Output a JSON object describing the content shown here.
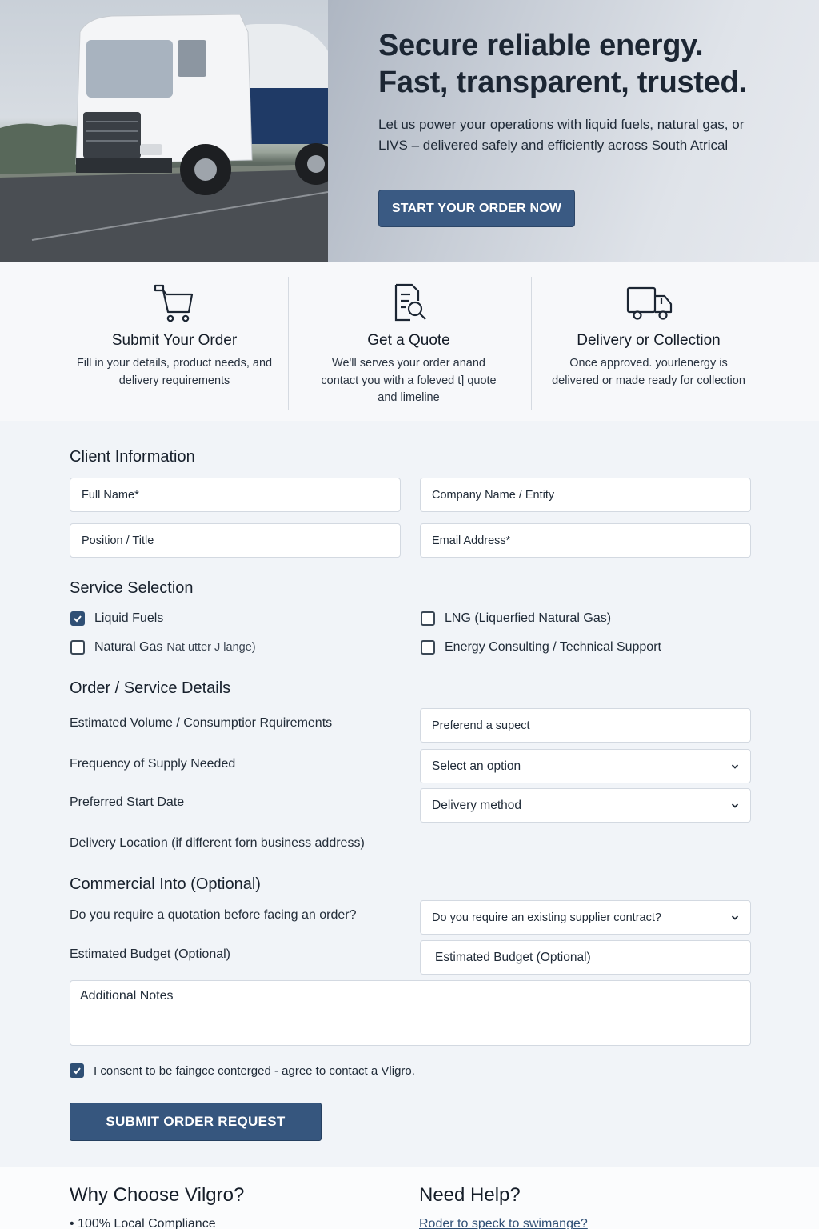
{
  "hero": {
    "title_line1": "Secure reliable energy.",
    "title_line2": "Fast, transparent, trusted.",
    "subtitle": "Let us power your operations with liquid fuels, natural gas, or LIVS – delivered safely and efficiently across South Atrical",
    "cta_label": "START YOUR ORDER NOW"
  },
  "steps": [
    {
      "icon": "shopping-cart-icon",
      "title": "Submit Your Order",
      "text": "Fill in your details, product needs, and delivery requirements"
    },
    {
      "icon": "document-search-icon",
      "title": "Get a Quote",
      "text": "We'll serves your order anand contact you with a foleved t] quote and limeline"
    },
    {
      "icon": "delivery-truck-icon",
      "title": "Delivery or Collection",
      "text": "Once approved. yourlenergy is delivered or made ready for collection"
    }
  ],
  "client_info": {
    "title": "Client Information",
    "full_name": "Full Name*",
    "company": "Company Name / Entity",
    "position": "Position / Title",
    "email": "Email Address*"
  },
  "service_selection": {
    "title": "Service Selection",
    "options": [
      {
        "label": "Liquid Fuels",
        "checked": true
      },
      {
        "label": "LNG (Liquerfied Natural Gas)",
        "checked": false
      },
      {
        "label": "Natural Gas",
        "suffix": "Nat utter J lange)",
        "checked": false
      },
      {
        "label": "Energy Consulting / Technical Support",
        "checked": false
      }
    ]
  },
  "order_details": {
    "title": "Order / Service Details",
    "volume_label": "Estimated Volume / Consumptior Rquirements",
    "volume_value": "Preferend a supect",
    "frequency_label": "Frequency of Supply Needed",
    "frequency_value": "Select an option",
    "start_label": "Preferred Start Date",
    "start_value": "Delivery method",
    "location_label": "Delivery Location (if different forn business address)"
  },
  "commercial": {
    "title": "Commercial Into (Optional)",
    "quote_label": "Do you require a quotation before facing an order?",
    "contract_value": "Do you require an existing supplier contract?",
    "budget_label": "Estimated Budget (Optional)",
    "budget_value": "Estimated Budget (Optional)",
    "notes_label": "Additional Notes"
  },
  "consent": {
    "text": "I consent to be faingce conterged - agree to contact a Vligro.",
    "checked": true
  },
  "submit_label": "SUBMIT ORDER REQUEST",
  "footer": {
    "why_title": "Why Choose Vilgro?",
    "why_item": "• 100% Local Compliance",
    "help_title": "Need Help?",
    "help_link": "Roder to speck to swimange?"
  },
  "colors": {
    "primary": "#36567e",
    "text": "#1f2a37",
    "background": "#f1f4f8"
  }
}
